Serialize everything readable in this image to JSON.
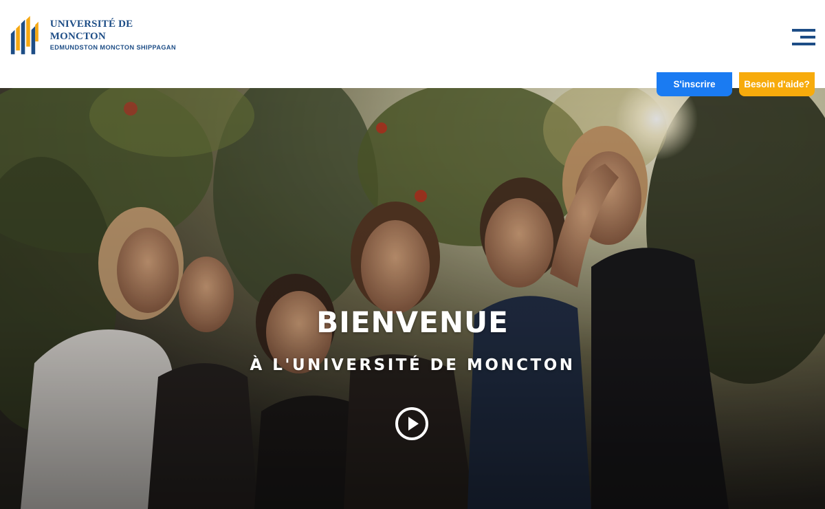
{
  "header": {
    "logo": {
      "name": "UNIVERSITÉ DE MONCTON",
      "campuses": "EDMUNDSTON  MONCTON  SHIPPAGAN"
    },
    "menu_icon": "hamburger-menu-icon"
  },
  "actions": {
    "register_label": "S'inscrire",
    "help_label": "Besoin d'aide?"
  },
  "hero": {
    "title": "BIENVENUE",
    "subtitle": "À L'UNIVERSITÉ DE MONCTON",
    "play_icon": "play-icon"
  },
  "colors": {
    "brand_blue": "#1d4d86",
    "brand_orange": "#f5a814",
    "register_button": "#1a7bf2",
    "help_button": "#f7ab0c"
  }
}
